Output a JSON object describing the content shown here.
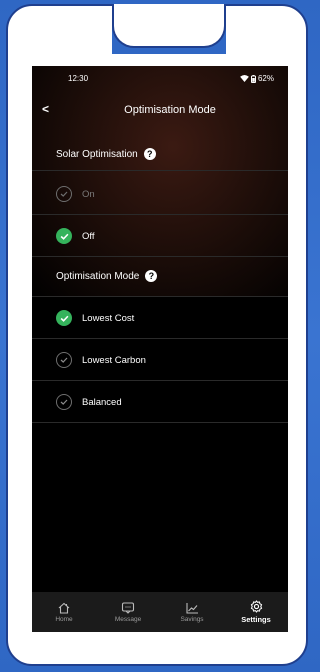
{
  "status_bar": {
    "time": "12:30",
    "battery": "62%"
  },
  "header": {
    "back": "<",
    "title": "Optimisation Mode"
  },
  "solar": {
    "title": "Solar Optimisation",
    "options": [
      {
        "label": "On",
        "selected": false
      },
      {
        "label": "Off",
        "selected": true
      }
    ]
  },
  "mode": {
    "title": "Optimisation Mode",
    "options": [
      {
        "label": "Lowest Cost",
        "selected": true
      },
      {
        "label": "Lowest Carbon",
        "selected": false
      },
      {
        "label": "Balanced",
        "selected": false
      }
    ]
  },
  "help_glyph": "?",
  "nav": [
    {
      "label": "Home",
      "icon": "home-icon",
      "active": false
    },
    {
      "label": "Message",
      "icon": "message-icon",
      "active": false
    },
    {
      "label": "Savings",
      "icon": "chart-icon",
      "active": false
    },
    {
      "label": "Settings",
      "icon": "gear-icon",
      "active": true
    }
  ],
  "colors": {
    "check_on": "#35b35c",
    "frame": "#2f67c4"
  }
}
